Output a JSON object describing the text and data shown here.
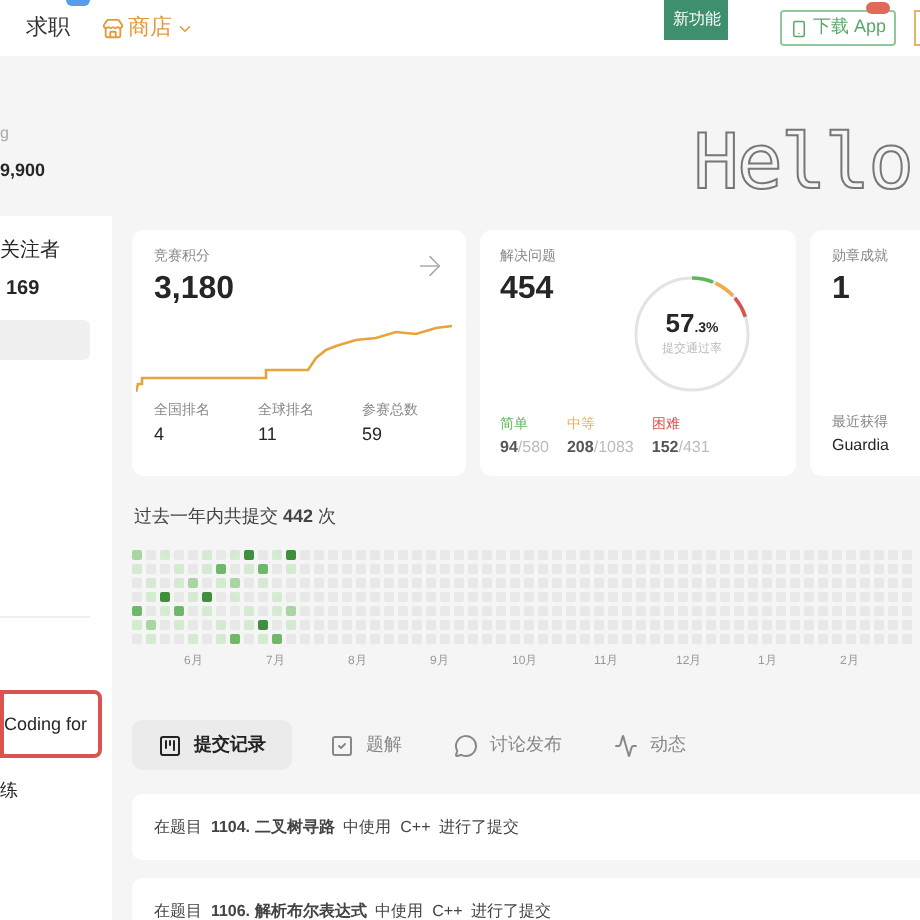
{
  "nav": {
    "items": [
      {
        "label": "求职",
        "kind": "plain"
      },
      {
        "label": "商店",
        "kind": "shop"
      }
    ],
    "new_feature": "新功能",
    "download": {
      "label": "下载 App"
    }
  },
  "profile": {
    "name_tail": "g",
    "points": "9,900",
    "banner": "Hello"
  },
  "sidebar": {
    "followers_label": "关注者",
    "followers": "169",
    "card_title": "Coding for",
    "item_tail": "练"
  },
  "cards": {
    "contest": {
      "label": "竞赛积分",
      "value": "3,180",
      "stats": [
        {
          "label": "全国排名",
          "value": "4"
        },
        {
          "label": "全球排名",
          "value": "11"
        },
        {
          "label": "参赛总数",
          "value": "59"
        }
      ]
    },
    "solved": {
      "label": "解决问题",
      "value": "454",
      "rate": "57",
      "rate_decimal": ".3%",
      "rate_label": "提交通过率",
      "levels": [
        {
          "label": "简单",
          "solved": "94",
          "total": "/580",
          "color": "#5cb85c"
        },
        {
          "label": "中等",
          "solved": "208",
          "total": "/1083",
          "color": "#f0ad4e"
        },
        {
          "label": "困难",
          "solved": "152",
          "total": "/431",
          "color": "#d9534f"
        }
      ]
    },
    "badges": {
      "label": "勋章成就",
      "value": "1",
      "recent_label": "最近获得",
      "recent": "Guardia"
    }
  },
  "activity": {
    "title": "过去一年内共提交 **442** 次",
    "months": [
      "6月",
      "7月",
      "8月",
      "9月",
      "10月",
      "11月",
      "12月",
      "1月",
      "2月"
    ]
  },
  "tabs": [
    {
      "label": "提交记录",
      "selected": true,
      "kind": "submissions"
    },
    {
      "label": "题解",
      "selected": false,
      "kind": "solutions"
    },
    {
      "label": "讨论发布",
      "selected": false,
      "kind": "discuss"
    },
    {
      "label": "动态",
      "selected": false,
      "kind": "activity"
    }
  ],
  "records": [
    {
      "text": "在题目  **1104. 二叉树寻路**  中使用  C++  进行了提交"
    },
    {
      "text": "在题目  **1106. 解析布尔表达式**  中使用  C++  进行了提交"
    }
  ]
}
